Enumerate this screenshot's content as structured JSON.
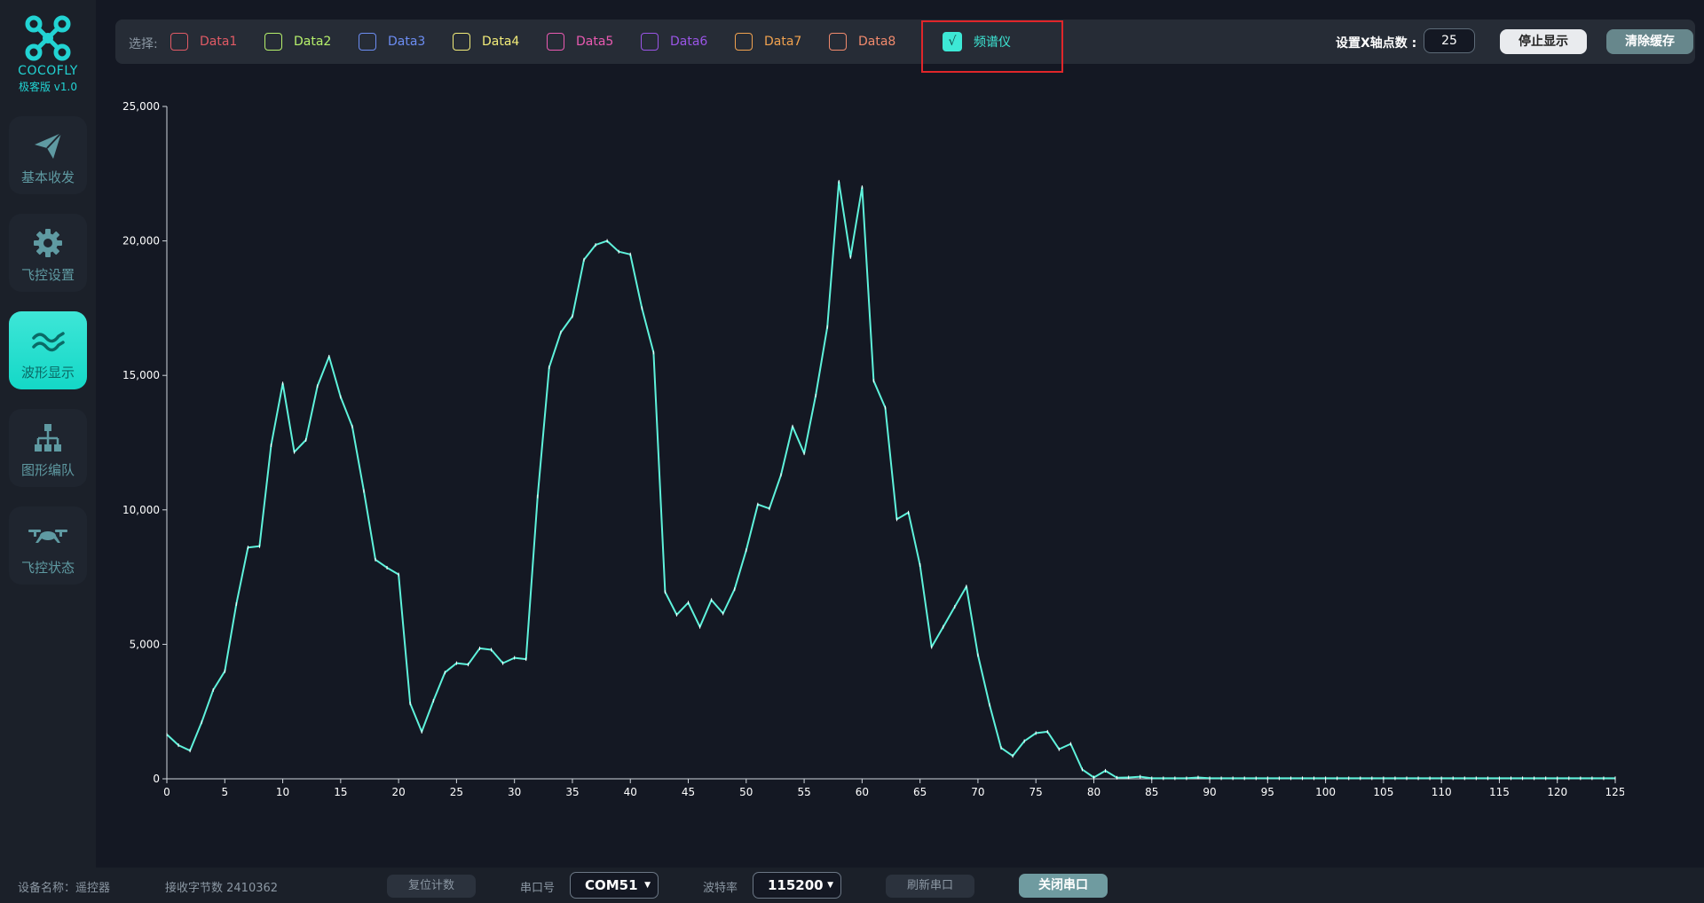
{
  "app": {
    "name": "COCOFLY",
    "version": "极客版 v1.0"
  },
  "sidebar": {
    "items": [
      {
        "label": "基本收发",
        "icon": "paper-plane-icon"
      },
      {
        "label": "飞控设置",
        "icon": "gear-icon"
      },
      {
        "label": "波形显示",
        "icon": "waveform-icon",
        "active": true
      },
      {
        "label": "图形编队",
        "icon": "hierarchy-icon"
      },
      {
        "label": "飞控状态",
        "icon": "drone-icon"
      }
    ]
  },
  "toolbar": {
    "select_label": "选择:",
    "channels": [
      {
        "label": "Data1",
        "color": "#e05a65"
      },
      {
        "label": "Data2",
        "color": "#b6f06b"
      },
      {
        "label": "Data3",
        "color": "#6c8df2"
      },
      {
        "label": "Data4",
        "color": "#f2ec79"
      },
      {
        "label": "Data5",
        "color": "#e95ab1"
      },
      {
        "label": "Data6",
        "color": "#9a55e6"
      },
      {
        "label": "Data7",
        "color": "#f0a24f"
      },
      {
        "label": "Data8",
        "color": "#f08a6d"
      }
    ],
    "spectrum": {
      "label": "频谱仪",
      "checked": true,
      "check_mark": "√",
      "color": "#3de8d6"
    },
    "xpoints_label": "设置X轴点数 :",
    "xpoints_value": "25",
    "stop_button": "停止显示",
    "clear_button": "清除缓存"
  },
  "chart_data": {
    "type": "line",
    "series": [
      {
        "color": "#5ef2db",
        "x": [
          0,
          1,
          2,
          3,
          4,
          5,
          6,
          7,
          8,
          9,
          10,
          11,
          12,
          13,
          14,
          15,
          16,
          17,
          18,
          19,
          20,
          21,
          22,
          23,
          24,
          25,
          26,
          27,
          28,
          29,
          30,
          31,
          32,
          33,
          34,
          35,
          36,
          37,
          38,
          39,
          40,
          41,
          42,
          43,
          44,
          45,
          46,
          47,
          48,
          49,
          50,
          51,
          52,
          53,
          54,
          55,
          56,
          57,
          58,
          59,
          60,
          61,
          62,
          63,
          64,
          65,
          66,
          67,
          68,
          69,
          70,
          71,
          72,
          73,
          74,
          75,
          76,
          77,
          78,
          79,
          80,
          81,
          82,
          83,
          84,
          85,
          86,
          87,
          88,
          89,
          90,
          91,
          92,
          93,
          94,
          95,
          96,
          97,
          98,
          99,
          100,
          101,
          102,
          103,
          104,
          105,
          106,
          107,
          108,
          109,
          110,
          111,
          112,
          113,
          114,
          115,
          116,
          117,
          118,
          119,
          120,
          121,
          122,
          123,
          124,
          125
        ],
        "y": [
          1650,
          1250,
          1050,
          2100,
          3300,
          4000,
          6500,
          8600,
          8650,
          12400,
          14700,
          12150,
          12600,
          14600,
          15700,
          14200,
          13100,
          10700,
          8150,
          7850,
          7600,
          2800,
          1750,
          2900,
          3950,
          4300,
          4250,
          4850,
          4800,
          4300,
          4500,
          4450,
          10500,
          15300,
          16600,
          17200,
          19300,
          19850,
          20000,
          19600,
          19500,
          17500,
          15850,
          6950,
          6100,
          6550,
          5650,
          6650,
          6150,
          7050,
          8500,
          10200,
          10050,
          11300,
          13100,
          12100,
          14250,
          16800,
          22200,
          19400,
          22000,
          14800,
          13800,
          9650,
          9900,
          7950,
          4900,
          5650,
          6400,
          7150,
          4600,
          2750,
          1150,
          850,
          1400,
          1700,
          1750,
          1100,
          1300,
          350,
          50,
          300,
          40,
          50,
          80,
          20,
          20,
          20,
          20,
          50,
          20,
          20,
          20,
          20,
          20,
          20,
          20,
          20,
          20,
          20,
          20,
          20,
          20,
          20,
          20,
          20,
          20,
          20,
          20,
          20,
          20,
          20,
          20,
          20,
          20,
          20,
          20,
          20,
          20,
          20,
          20,
          20,
          20,
          20,
          20,
          20
        ]
      }
    ],
    "xlim": [
      0,
      125
    ],
    "ylim": [
      0,
      25000
    ],
    "x_ticks": [
      0,
      5,
      10,
      15,
      20,
      25,
      30,
      35,
      40,
      45,
      50,
      55,
      60,
      65,
      70,
      75,
      80,
      85,
      90,
      95,
      100,
      105,
      110,
      115,
      120,
      125
    ],
    "y_ticks": [
      0,
      5000,
      10000,
      15000,
      20000,
      25000
    ],
    "y_tick_labels": [
      "0",
      "5,000",
      "10,000",
      "15,000",
      "20,000",
      "25,000"
    ],
    "grid": false,
    "title": "",
    "xlabel": "",
    "ylabel": ""
  },
  "statusbar": {
    "device_label": "设备名称：遥控器",
    "bytes_label": "接收字节数 2410362",
    "reset_button": "复位计数",
    "port_label": "串口号",
    "port_value": "COM51",
    "baud_label": "波特率",
    "baud_value": "115200",
    "refresh_button": "刷新串口",
    "close_button": "关闭串口"
  }
}
